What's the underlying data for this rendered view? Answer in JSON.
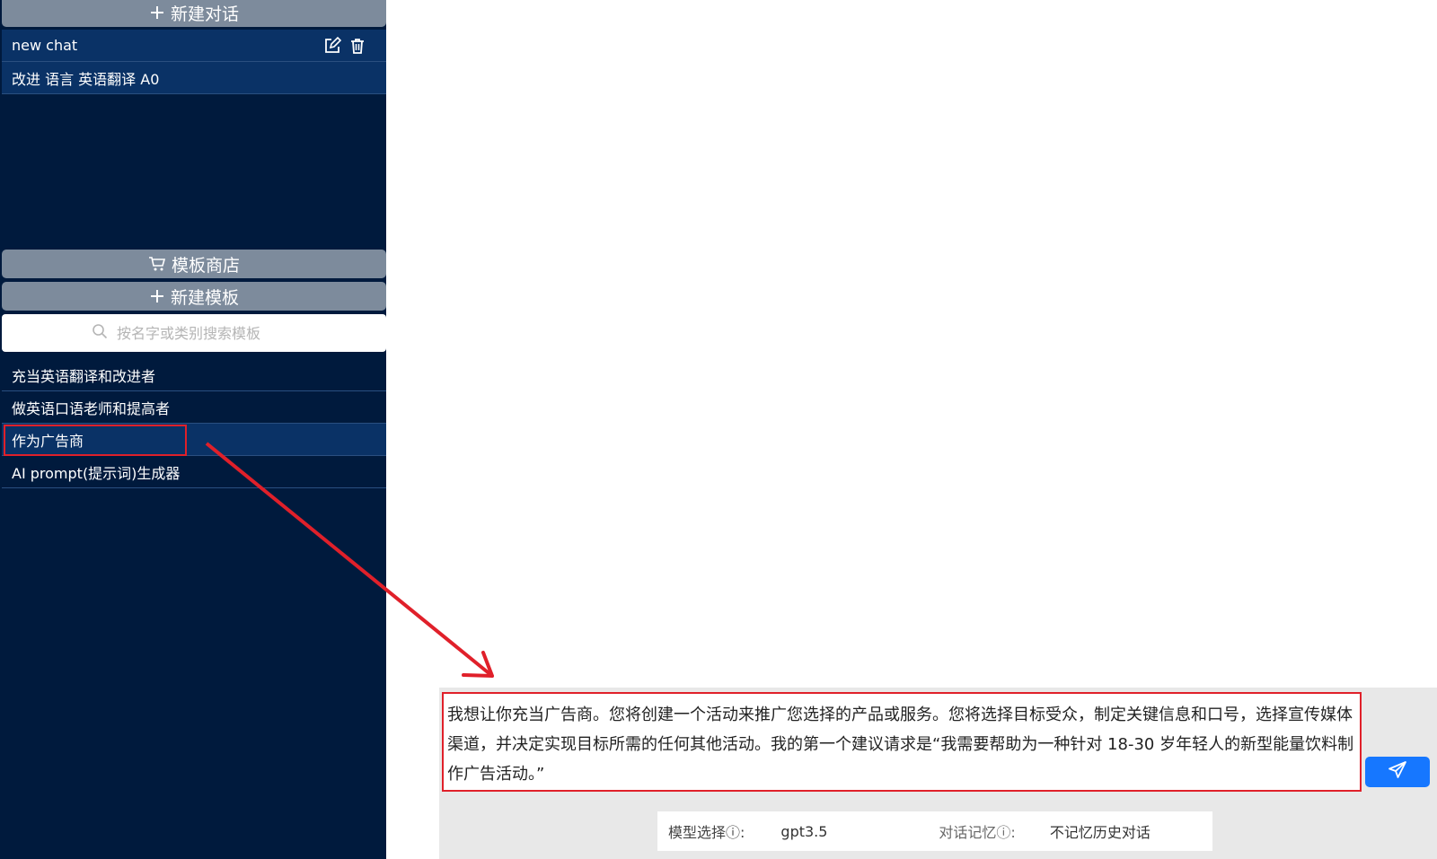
{
  "sidebar": {
    "new_chat_label": "新建对话",
    "chats": [
      {
        "label": "new chat"
      },
      {
        "label": "改进 语言 英语翻译 A0"
      }
    ],
    "template_store_label": "模板商店",
    "new_template_label": "新建模板",
    "search_placeholder": "按名字或类别搜索模板",
    "templates": [
      {
        "label": "充当英语翻译和改进者"
      },
      {
        "label": "做英语口语老师和提高者"
      },
      {
        "label": "作为广告商"
      },
      {
        "label": "AI prompt(提示词)生成器"
      }
    ]
  },
  "main": {
    "prompt_text": "我想让你充当广告商。您将创建一个活动来推广您选择的产品或服务。您将选择目标受众，制定关键信息和口号，选择宣传媒体渠道，并决定实现目标所需的任何其他活动。我的第一个建议请求是“我需要帮助为一种针对 18-30 岁年轻人的新型能量饮料制作广告活动。”",
    "model_label": "模型选择ⓘ:",
    "model_value": "gpt3.5",
    "memory_label": "对话记忆ⓘ:",
    "memory_value": "不记忆历史对话"
  },
  "colors": {
    "sidebar_bg": "#001a3d",
    "selected_bg": "#0a3266",
    "button_bg": "#7d8b9c",
    "accent": "#1677ff",
    "annotation": "#e0202a"
  }
}
